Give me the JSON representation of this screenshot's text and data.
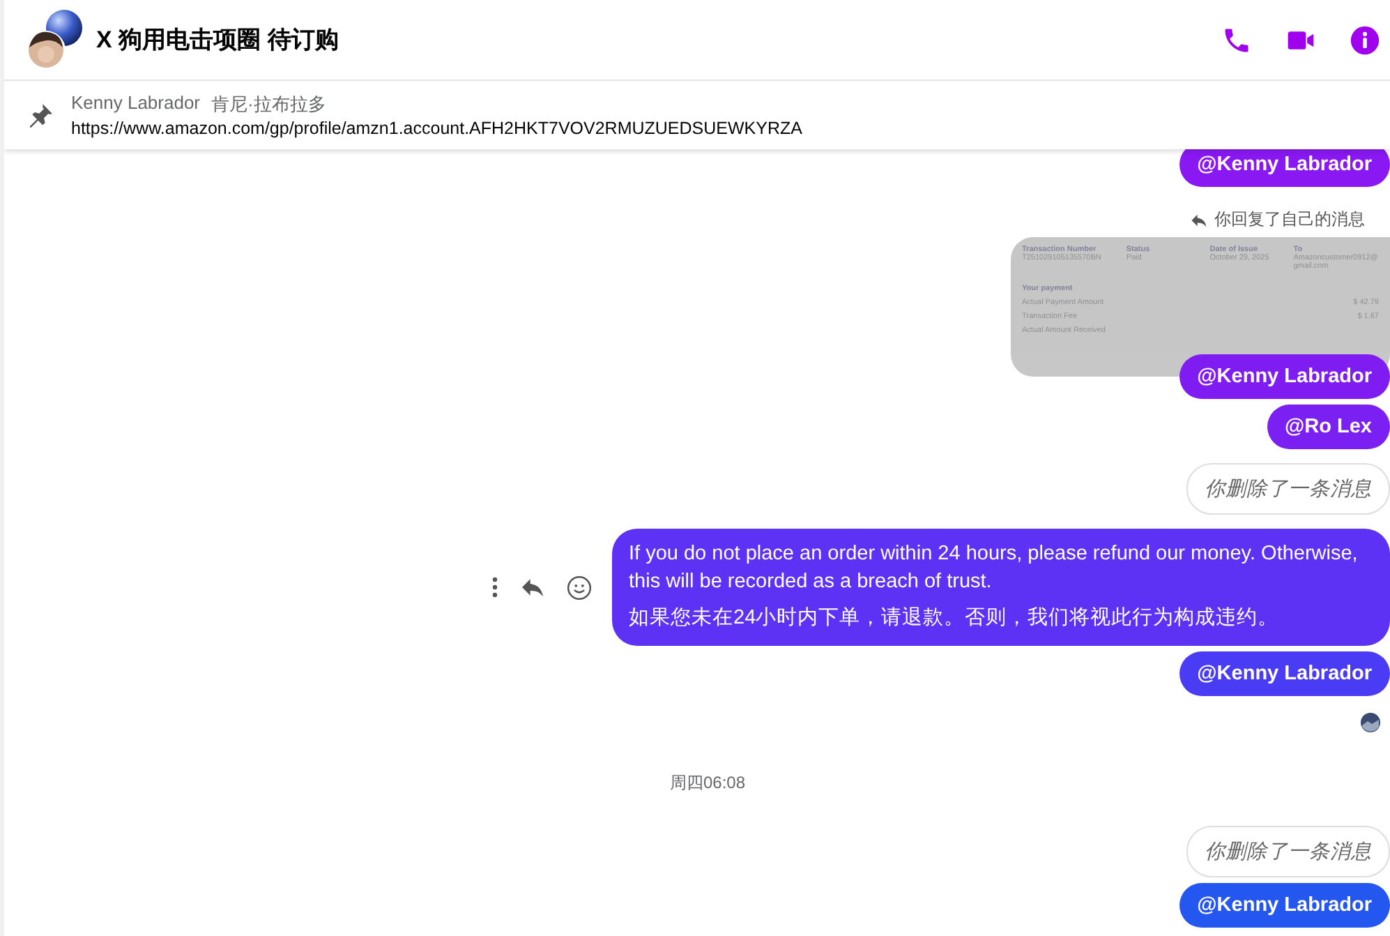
{
  "header": {
    "title": "X 狗用电击项圈 待订购",
    "actions": [
      {
        "kind": "phone"
      },
      {
        "kind": "video"
      },
      {
        "kind": "info"
      }
    ]
  },
  "pinned": {
    "sender": "Kenny Labrador",
    "sender_alt": "肯尼·拉布拉多",
    "text": "https://www.amazon.com/gp/profile/amzn1.account.AFH2HKT7VOV2RMUZUEDSUEWKYRZA"
  },
  "messages": [
    {
      "kind": "mention",
      "text": "@Kenny Labrador",
      "color": "#8a18f2"
    },
    {
      "kind": "reply_note",
      "text": "你回复了自己的消息"
    },
    {
      "kind": "screenshot",
      "columns": [
        {
          "head": "Transaction Number",
          "value": "T251029105135570BN"
        },
        {
          "head": "Status",
          "value": "Paid"
        },
        {
          "head": "Date of Issue",
          "value": "October 29, 2025"
        },
        {
          "head": "To",
          "value": "Amazoncustomer0912@gmail.com"
        }
      ],
      "section": "Your payment",
      "rows": [
        {
          "label": "Actual Payment Amount",
          "value": "$ 42.79"
        },
        {
          "label": "Transaction Fee",
          "value": "$ 1.67"
        },
        {
          "label": "Actual Amount Received",
          "value": ""
        }
      ]
    },
    {
      "kind": "mention",
      "text": "@Kenny Labrador",
      "color": "#7e1cf2"
    },
    {
      "kind": "mention",
      "text": "@Ro Lex",
      "color": "#7a20f2"
    },
    {
      "kind": "deleted",
      "text": "你删除了一条消息"
    },
    {
      "kind": "text",
      "lines": [
        "If you do not place an order within 24 hours, please refund our money. Otherwise, this will be recorded as a breach of trust.",
        "如果您未在24小时内下单，请退款。否则，我们将视此行为构成违约。"
      ],
      "color": "#5e32f4"
    },
    {
      "kind": "mention",
      "text": "@Kenny Labrador",
      "color": "#4a3cf4"
    },
    {
      "kind": "seen"
    },
    {
      "kind": "time",
      "text": "周四06:08"
    },
    {
      "kind": "deleted",
      "text": "你删除了一条消息"
    },
    {
      "kind": "mention",
      "text": "@Kenny Labrador",
      "color": "#2456f0"
    }
  ]
}
